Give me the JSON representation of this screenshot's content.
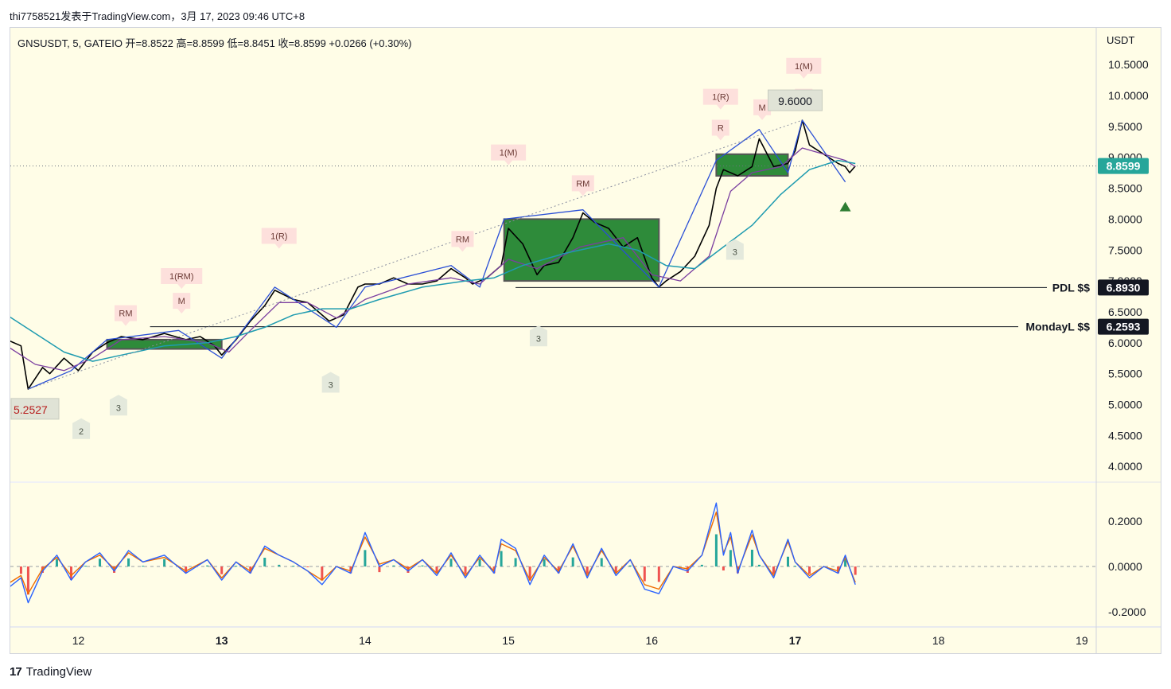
{
  "header": {
    "credit": "thi7758521发表于TradingView.com，3月 17, 2023 09:46 UTC+8",
    "legend": "GNSUSDT, 5, GATEIO  开=8.8522  高=8.8599  低=8.8451  收=8.8599  +0.0266 (+0.30%)"
  },
  "footer": {
    "brand": "TradingView"
  },
  "colors": {
    "background": "#fffde7",
    "price_line": "#000000",
    "zigzag": "#2a4fd6",
    "ma_fast": "#7b3fa0",
    "ma_slow": "#1e9bb0",
    "box_fill": "#2e8b3a",
    "last_price_tag": "#26a69a",
    "level_tag": "#131722",
    "osc_blue": "#2962ff",
    "osc_orange": "#ef6c00",
    "hist_pos": "#26a69a",
    "hist_neg": "#ef5350"
  },
  "chart_data": [
    {
      "type": "line",
      "title": "GNSUSDT, 5, GATEIO",
      "ohlc_last": {
        "open": 8.8522,
        "high": 8.8599,
        "low": 8.8451,
        "close": 8.8599,
        "change": 0.0266,
        "change_pct": 0.3
      },
      "axis_currency": "USDT",
      "y_ticks": [
        "10.5000",
        "10.0000",
        "9.5000",
        "9.0000",
        "8.5000",
        "8.0000",
        "7.5000",
        "7.0000",
        "6.5000",
        "6.0000",
        "5.5000",
        "5.0000",
        "4.5000",
        "4.0000"
      ],
      "ylim": [
        3.72,
        10.92
      ],
      "x_ticks": [
        "12",
        "13",
        "14",
        "15",
        "16",
        "17",
        "18",
        "19"
      ],
      "xlim": [
        11.5,
        19.05
      ],
      "last_price": "8.8599",
      "high_label": "9.6000",
      "low_label": "5.2527",
      "series": [
        {
          "kind": "price",
          "x": [
            11.5,
            11.6,
            11.65,
            11.75,
            11.8,
            11.9,
            12.0,
            12.1,
            12.2,
            12.3,
            12.45,
            12.6,
            12.75,
            12.85,
            12.95,
            13.0,
            13.1,
            13.2,
            13.3,
            13.37,
            13.5,
            13.6,
            13.75,
            13.85,
            13.95,
            14.0,
            14.1,
            14.2,
            14.3,
            14.4,
            14.5,
            14.6,
            14.7,
            14.75,
            14.85,
            14.95,
            15.0,
            15.1,
            15.2,
            15.25,
            15.35,
            15.45,
            15.52,
            15.6,
            15.7,
            15.8,
            15.9,
            16.0,
            16.05,
            16.1,
            16.2,
            16.3,
            16.4,
            16.45,
            16.5,
            16.6,
            16.7,
            16.75,
            16.85,
            16.95,
            17.0,
            17.05,
            17.1,
            17.2,
            17.3,
            17.35,
            17.38,
            17.42
          ],
          "y": [
            6.05,
            5.95,
            5.25,
            5.6,
            5.5,
            5.75,
            5.55,
            5.85,
            6.0,
            6.1,
            6.05,
            6.15,
            6.05,
            6.1,
            5.95,
            5.8,
            6.05,
            6.35,
            6.6,
            6.85,
            6.7,
            6.65,
            6.35,
            6.45,
            6.9,
            6.95,
            6.95,
            7.05,
            6.95,
            6.95,
            7.0,
            7.2,
            7.05,
            6.95,
            7.05,
            7.25,
            7.85,
            7.6,
            7.1,
            7.25,
            7.3,
            7.7,
            8.1,
            7.95,
            7.85,
            7.55,
            7.7,
            7.05,
            6.9,
            7.0,
            7.15,
            7.4,
            7.9,
            8.5,
            8.8,
            8.7,
            8.85,
            9.3,
            8.85,
            8.9,
            9.1,
            9.6,
            9.2,
            9.05,
            8.9,
            8.85,
            8.75,
            8.86
          ]
        },
        {
          "kind": "zigzag",
          "x": [
            11.65,
            11.95,
            12.2,
            12.7,
            13.0,
            13.37,
            13.8,
            14.0,
            14.6,
            14.8,
            14.97,
            15.52,
            16.05,
            16.45,
            16.75,
            16.95,
            17.05,
            17.35
          ],
          "y": [
            5.25,
            5.55,
            6.05,
            6.2,
            5.75,
            6.9,
            6.25,
            6.9,
            7.25,
            6.9,
            8.0,
            8.15,
            6.9,
            8.95,
            9.45,
            8.75,
            9.6,
            8.6
          ]
        },
        {
          "kind": "ma_fast",
          "x": [
            11.5,
            11.7,
            11.9,
            12.1,
            12.3,
            12.6,
            12.9,
            13.05,
            13.2,
            13.4,
            13.6,
            13.8,
            14.0,
            14.3,
            14.6,
            14.8,
            15.0,
            15.2,
            15.5,
            15.8,
            16.0,
            16.2,
            16.4,
            16.55,
            16.7,
            16.9,
            17.05,
            17.2,
            17.35,
            17.42
          ],
          "y": [
            5.95,
            5.65,
            5.55,
            5.75,
            6.05,
            6.1,
            6.0,
            5.85,
            6.2,
            6.65,
            6.65,
            6.4,
            6.7,
            6.95,
            7.05,
            6.95,
            7.35,
            7.2,
            7.55,
            7.7,
            7.1,
            7.0,
            7.4,
            8.45,
            8.75,
            8.85,
            9.15,
            9.05,
            8.95,
            8.85
          ]
        },
        {
          "kind": "ma_slow",
          "x": [
            11.5,
            11.7,
            11.9,
            12.1,
            12.3,
            12.6,
            12.9,
            13.1,
            13.3,
            13.5,
            13.7,
            13.9,
            14.1,
            14.4,
            14.7,
            14.9,
            15.1,
            15.4,
            15.7,
            15.9,
            16.1,
            16.3,
            16.5,
            16.7,
            16.9,
            17.1,
            17.3,
            17.42
          ],
          "y": [
            6.45,
            6.15,
            5.85,
            5.7,
            5.8,
            5.95,
            6.0,
            6.1,
            6.25,
            6.45,
            6.55,
            6.55,
            6.7,
            6.9,
            7.0,
            7.05,
            7.25,
            7.45,
            7.6,
            7.5,
            7.25,
            7.2,
            7.55,
            7.9,
            8.4,
            8.8,
            8.95,
            8.9
          ]
        },
        {
          "kind": "trendline",
          "x": [
            11.65,
            17.05
          ],
          "y": [
            5.25,
            9.6
          ]
        }
      ],
      "zones": [
        {
          "x0": 12.2,
          "x1": 13.0,
          "y0": 5.9,
          "y1": 6.05
        },
        {
          "x0": 14.97,
          "x1": 16.05,
          "y0": 7.0,
          "y1": 8.0
        },
        {
          "x0": 16.45,
          "x1": 16.95,
          "y0": 8.7,
          "y1": 9.05
        }
      ],
      "horizontal_levels": [
        {
          "label": "PDL $$",
          "value": "6.8930"
        },
        {
          "label": "MondayL $$",
          "value": "6.2593"
        }
      ],
      "annotations": [
        {
          "text": "RM",
          "x": 12.33,
          "y": 6.35,
          "style": "red"
        },
        {
          "text": "1(RM)",
          "x": 12.72,
          "y": 6.95,
          "style": "red"
        },
        {
          "text": "M",
          "x": 12.72,
          "y": 6.55,
          "style": "red"
        },
        {
          "text": "1(R)",
          "x": 13.4,
          "y": 7.6,
          "style": "red"
        },
        {
          "text": "RM",
          "x": 14.68,
          "y": 7.55,
          "style": "red"
        },
        {
          "text": "1(M)",
          "x": 15.0,
          "y": 8.95,
          "style": "red"
        },
        {
          "text": "RM",
          "x": 15.52,
          "y": 8.45,
          "style": "red"
        },
        {
          "text": "1(R)",
          "x": 16.48,
          "y": 9.85,
          "style": "red"
        },
        {
          "text": "R",
          "x": 16.48,
          "y": 9.35,
          "style": "red"
        },
        {
          "text": "M",
          "x": 16.77,
          "y": 9.68,
          "style": "red"
        },
        {
          "text": "1(M)",
          "x": 17.06,
          "y": 10.35,
          "style": "red"
        },
        {
          "text": "M",
          "x": 17.06,
          "y": 9.85,
          "style": "red"
        },
        {
          "text": "3",
          "x": 12.28,
          "y": 5.08,
          "style": "gray"
        },
        {
          "text": "2",
          "x": 12.02,
          "y": 4.7,
          "style": "gray"
        },
        {
          "text": "3",
          "x": 13.76,
          "y": 5.45,
          "style": "gray"
        },
        {
          "text": "3",
          "x": 15.21,
          "y": 6.2,
          "style": "gray"
        },
        {
          "text": "3",
          "x": 16.58,
          "y": 7.6,
          "style": "gray"
        }
      ]
    },
    {
      "type": "line",
      "title": "",
      "y_ticks": [
        "0.2000",
        "0.0000",
        "-0.2000"
      ],
      "ylim": [
        -0.27,
        0.37
      ],
      "x": [
        11.5,
        11.6,
        11.65,
        11.75,
        11.85,
        11.95,
        12.05,
        12.15,
        12.25,
        12.35,
        12.45,
        12.6,
        12.75,
        12.9,
        13.0,
        13.1,
        13.2,
        13.3,
        13.4,
        13.5,
        13.6,
        13.7,
        13.8,
        13.9,
        14.0,
        14.1,
        14.2,
        14.3,
        14.4,
        14.5,
        14.6,
        14.7,
        14.8,
        14.9,
        14.95,
        15.05,
        15.15,
        15.25,
        15.35,
        15.45,
        15.55,
        15.65,
        15.75,
        15.85,
        15.95,
        16.05,
        16.15,
        16.25,
        16.35,
        16.45,
        16.5,
        16.55,
        16.6,
        16.7,
        16.75,
        16.85,
        16.95,
        17.0,
        17.1,
        17.2,
        17.3,
        17.35,
        17.42
      ],
      "series": [
        {
          "name": "",
          "values": [
            -0.1,
            -0.05,
            -0.16,
            -0.02,
            0.05,
            -0.06,
            0.02,
            0.06,
            -0.02,
            0.07,
            0.02,
            0.05,
            -0.03,
            0.03,
            -0.06,
            0.02,
            -0.03,
            0.09,
            0.05,
            0.02,
            -0.02,
            -0.08,
            0.0,
            -0.03,
            0.15,
            0.0,
            0.03,
            -0.02,
            0.03,
            -0.04,
            0.06,
            -0.05,
            0.05,
            -0.03,
            0.12,
            0.08,
            -0.08,
            0.05,
            -0.03,
            0.1,
            -0.05,
            0.08,
            -0.04,
            0.03,
            -0.1,
            -0.12,
            0.0,
            -0.02,
            0.05,
            0.28,
            0.05,
            0.15,
            -0.03,
            0.16,
            0.05,
            -0.05,
            0.12,
            0.02,
            -0.05,
            0.0,
            -0.03,
            0.05,
            -0.08
          ]
        },
        {
          "name": "",
          "values": [
            -0.08,
            -0.04,
            -0.12,
            -0.01,
            0.04,
            -0.04,
            0.02,
            0.05,
            -0.01,
            0.06,
            0.02,
            0.04,
            -0.02,
            0.03,
            -0.05,
            0.02,
            -0.02,
            0.08,
            0.05,
            0.02,
            -0.02,
            -0.06,
            0.0,
            -0.02,
            0.13,
            0.01,
            0.03,
            -0.01,
            0.03,
            -0.03,
            0.05,
            -0.04,
            0.04,
            -0.02,
            0.1,
            0.07,
            -0.06,
            0.04,
            -0.02,
            0.09,
            -0.04,
            0.07,
            -0.03,
            0.03,
            -0.08,
            -0.1,
            0.0,
            -0.01,
            0.05,
            0.24,
            0.06,
            0.13,
            -0.02,
            0.14,
            0.05,
            -0.04,
            0.11,
            0.02,
            -0.04,
            0.0,
            -0.02,
            0.04,
            -0.07
          ]
        }
      ]
    }
  ]
}
